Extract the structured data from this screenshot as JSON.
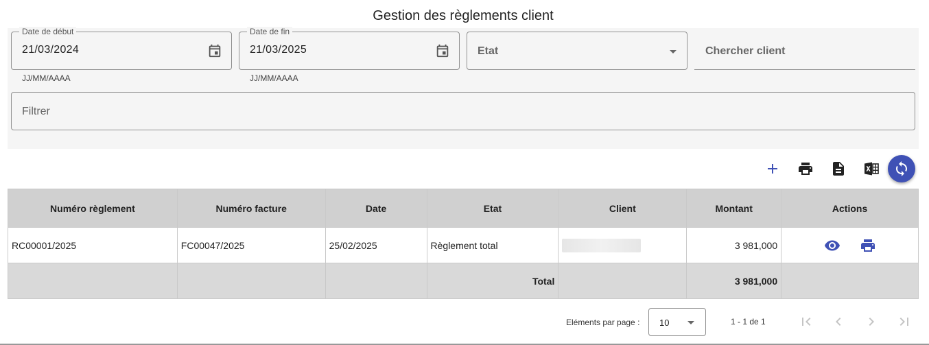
{
  "page": {
    "title": "Gestion des règlements client"
  },
  "filters": {
    "start_date": {
      "label": "Date de début",
      "value": "21/03/2024",
      "hint": "JJ/MM/AAAA"
    },
    "end_date": {
      "label": "Date de fin",
      "value": "21/03/2025",
      "hint": "JJ/MM/AAAA"
    },
    "state": {
      "placeholder": "Etat"
    },
    "client_search": {
      "placeholder": "Chercher client"
    },
    "filter": {
      "placeholder": "Filtrer"
    }
  },
  "toolbar": {
    "icons": [
      "add-icon",
      "print-icon",
      "document-icon",
      "excel-icon",
      "refresh-icon"
    ],
    "accent_color": "#3f51b5"
  },
  "table": {
    "columns": [
      "Numéro règlement",
      "Numéro facture",
      "Date",
      "Etat",
      "Client",
      "Montant",
      "Actions"
    ],
    "rows": [
      {
        "reglement": "RC00001/2025",
        "facture": "FC00047/2025",
        "date": "25/02/2025",
        "etat": "Règlement total",
        "montant": "3 981,000"
      }
    ],
    "footer": {
      "label": "Total",
      "montant": "3 981,000"
    },
    "header_bg": "#d0d0d0"
  },
  "paginator": {
    "label": "Eléments par page :",
    "page_size": "10",
    "range": "1 - 1 de 1"
  }
}
